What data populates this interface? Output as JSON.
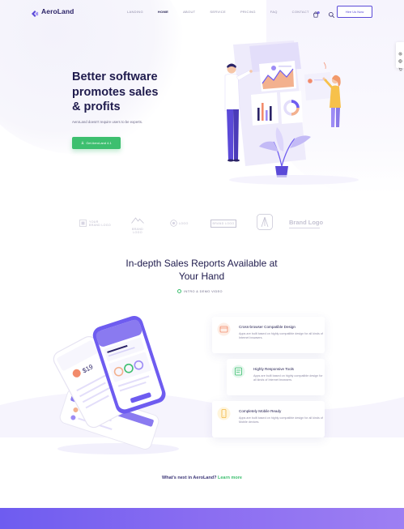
{
  "brand": {
    "name": "AeroLand"
  },
  "nav": {
    "items": [
      {
        "label": "LANDING"
      },
      {
        "label": "HOME"
      },
      {
        "label": "ABOUT"
      },
      {
        "label": "SERVICE"
      },
      {
        "label": "PRICING"
      },
      {
        "label": "FAQ"
      },
      {
        "label": "CONTACT"
      }
    ],
    "active_item": "HOME",
    "cart_badge": "0",
    "cta_label": "Hire Us Now"
  },
  "hero": {
    "title_line1": "Better software",
    "title_line2": "promotes sales",
    "title_line3": "& profits",
    "subtitle": "AeroLand doesn't require users to be experts.",
    "button_label": "Get AeroLand 4.1"
  },
  "brands": {
    "logo1": [
      "YOUR",
      "BRAND LOGO"
    ],
    "logo2": [
      "BRAND",
      "LOGO"
    ],
    "logo3": "LOGO",
    "logo4": "BRAND LOGO",
    "logo6": "Brand Logo"
  },
  "reports": {
    "title_line1": "In-depth Sales Reports Available at",
    "title_line2": "Your Hand",
    "video_label": "INTRO & DEMO VIDEO",
    "features": [
      {
        "title": "Cross-browser Compatible Design",
        "desc": "Apps are built based on highly compatible design for all kinds of Internet browsers.",
        "icon": "browser-icon"
      },
      {
        "title": "Highly Responsive Tools",
        "desc": "Apps are built based on highly compatible design for all kinds of Internet browsers.",
        "icon": "responsive-tools-icon"
      },
      {
        "title": "Completely Mobile Ready",
        "desc": "Apps are built based on highly compatible design for all kinds of Mobile devices.",
        "icon": "mobile-icon"
      }
    ]
  },
  "next": {
    "text": "What's next in AeroLand?",
    "link_label": "Learn more"
  },
  "colors": {
    "primary": "#5b4ad8",
    "accent_green": "#3dbf6f",
    "heading": "#1f1b4d",
    "footer_gradient_start": "#6e5cf0",
    "footer_gradient_end": "#9d7ff3"
  }
}
